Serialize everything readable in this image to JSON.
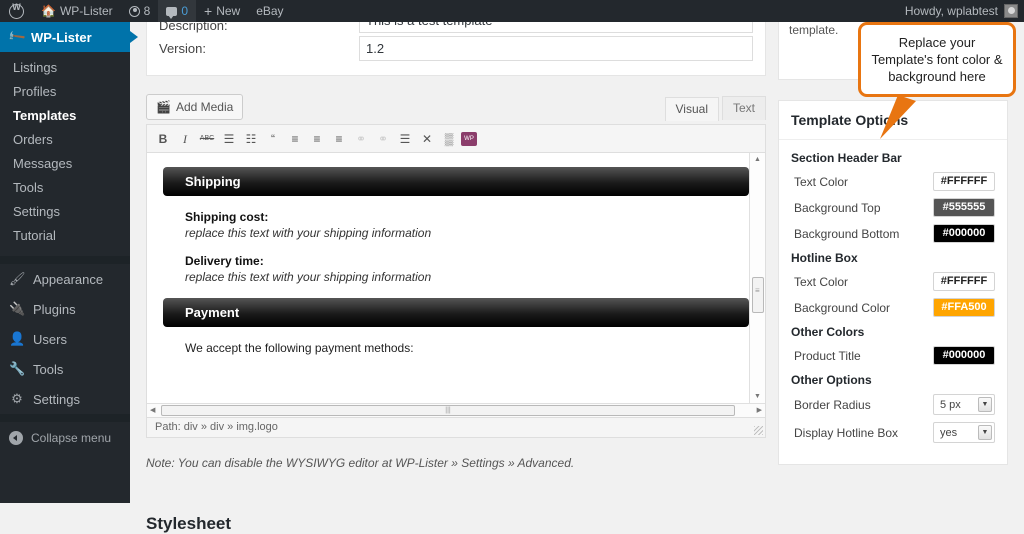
{
  "adminbar": {
    "wp_logo": "wordpress-icon",
    "site_name": "WP-Lister",
    "updates_count": "8",
    "comments_count": "0",
    "new_label": "New",
    "ebay_label": "eBay",
    "howdy": "Howdy, wplabtest"
  },
  "sidebar": {
    "current": "WP-Lister",
    "sub_items": [
      {
        "label": "Listings",
        "active": false
      },
      {
        "label": "Profiles",
        "active": false
      },
      {
        "label": "Templates",
        "active": true
      },
      {
        "label": "Orders",
        "active": false
      },
      {
        "label": "Messages",
        "active": false
      },
      {
        "label": "Tools",
        "active": false
      },
      {
        "label": "Settings",
        "active": false
      },
      {
        "label": "Tutorial",
        "active": false
      }
    ],
    "core_items": [
      {
        "label": "Appearance",
        "icon": "paintbrush-icon"
      },
      {
        "label": "Plugins",
        "icon": "plug-icon"
      },
      {
        "label": "Users",
        "icon": "user-icon"
      },
      {
        "label": "Tools",
        "icon": "wrench-icon"
      },
      {
        "label": "Settings",
        "icon": "sliders-icon"
      }
    ],
    "collapse_label": "Collapse menu"
  },
  "form": {
    "description_label": "Description:",
    "description_value": "This is a test template",
    "version_label": "Version:",
    "version_value": "1.2"
  },
  "editor": {
    "add_media_label": "Add Media",
    "tabs": [
      {
        "label": "Visual",
        "active": true
      },
      {
        "label": "Text",
        "active": false
      }
    ],
    "toolbar": [
      {
        "name": "bold-icon",
        "glyph": "B",
        "dim": false
      },
      {
        "name": "italic-icon",
        "glyph": "I",
        "dim": false
      },
      {
        "name": "strikethrough-icon",
        "glyph": "ABC",
        "dim": false
      },
      {
        "name": "unordered-list-icon",
        "glyph": "☰",
        "dim": false
      },
      {
        "name": "ordered-list-icon",
        "glyph": "☷",
        "dim": false
      },
      {
        "name": "blockquote-icon",
        "glyph": "“",
        "dim": false
      },
      {
        "name": "align-left-icon",
        "glyph": "≡",
        "dim": false
      },
      {
        "name": "align-center-icon",
        "glyph": "≡",
        "dim": false
      },
      {
        "name": "align-right-icon",
        "glyph": "≡",
        "dim": false
      },
      {
        "name": "insert-link-icon",
        "glyph": "⚭",
        "dim": true
      },
      {
        "name": "unlink-icon",
        "glyph": "⚭",
        "dim": true
      },
      {
        "name": "insert-more-tag-icon",
        "glyph": "☰",
        "dim": false
      },
      {
        "name": "distraction-free-icon",
        "glyph": "✕",
        "dim": false
      },
      {
        "name": "spellcheck-icon",
        "glyph": "▒",
        "dim": false
      },
      {
        "name": "kitchen-sink-icon",
        "glyph": "WP",
        "dim": false
      }
    ],
    "canvas": {
      "sections": [
        {
          "header": "Shipping",
          "rows": [
            {
              "key": "Shipping cost:",
              "value": "replace this text with your shipping information"
            },
            {
              "key": "Delivery time:",
              "value": "replace this text with your shipping information"
            }
          ],
          "plain": ""
        },
        {
          "header": "Payment",
          "rows": [],
          "plain": "We accept the following payment methods:"
        }
      ]
    },
    "path_label": "Path: div » div » img.logo",
    "note": "Note: You can disable the WYSIWYG editor at WP-Lister » Settings » Advanced.",
    "stylesheet_heading": "Stylesheet"
  },
  "side_top_card": {
    "text": "template."
  },
  "options": {
    "title": "Template Options",
    "groups": [
      {
        "title": "Section Header Bar",
        "rows": [
          {
            "label": "Text Color",
            "value": "#FFFFFF",
            "bg": "#FFFFFF",
            "fg": "#222222",
            "type": "color"
          },
          {
            "label": "Background Top",
            "value": "#555555",
            "bg": "#555555",
            "fg": "#FFFFFF",
            "type": "color"
          },
          {
            "label": "Background Bottom",
            "value": "#000000",
            "bg": "#000000",
            "fg": "#FFFFFF",
            "type": "color"
          }
        ]
      },
      {
        "title": "Hotline Box",
        "rows": [
          {
            "label": "Text Color",
            "value": "#FFFFFF",
            "bg": "#FFFFFF",
            "fg": "#222222",
            "type": "color"
          },
          {
            "label": "Background Color",
            "value": "#FFA500",
            "bg": "#FFA500",
            "fg": "#FFFFFF",
            "type": "color"
          }
        ]
      },
      {
        "title": "Other Colors",
        "rows": [
          {
            "label": "Product Title",
            "value": "#000000",
            "bg": "#000000",
            "fg": "#FFFFFF",
            "type": "color"
          }
        ]
      },
      {
        "title": "Other Options",
        "rows": [
          {
            "label": "Border Radius",
            "value": "5 px",
            "type": "select"
          },
          {
            "label": "Display Hotline Box",
            "value": "yes",
            "type": "select"
          }
        ]
      }
    ]
  },
  "callout": {
    "text": "Replace your Template's font color & background here",
    "border_color": "#E87511"
  }
}
